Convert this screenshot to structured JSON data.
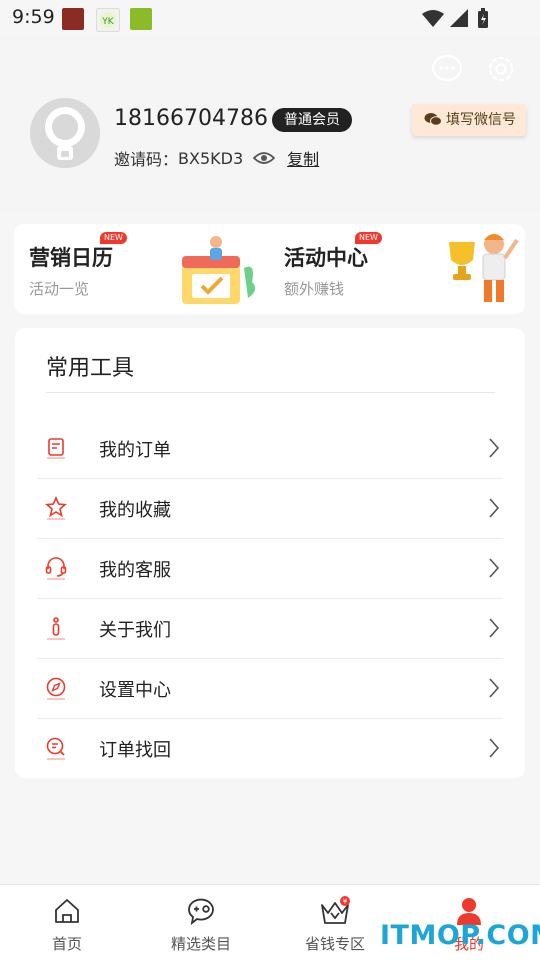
{
  "status_bar": {
    "time": "9:59",
    "app_icons": [
      "calligraphy-app-icon",
      "yk-app-icon",
      "green-app-icon"
    ],
    "indicators": [
      "wifi-icon",
      "signal-icon",
      "battery-icon"
    ]
  },
  "profile": {
    "phone": "18166704786",
    "member_level": "普通会员",
    "invite_label": "邀请码：",
    "invite_code": "BX5KD3",
    "copy_label": "复制",
    "wechat_button": "填写微信号"
  },
  "promos": [
    {
      "title": "营销日历",
      "subtitle": "活动一览",
      "tag": "NEW",
      "icon": "calendar-illustration"
    },
    {
      "title": "活动中心",
      "subtitle": "额外赚钱",
      "tag": "NEW",
      "icon": "trophy-illustration"
    }
  ],
  "tools": {
    "title": "常用工具",
    "items": [
      {
        "label": "我的订单",
        "icon": "order-icon"
      },
      {
        "label": "我的收藏",
        "icon": "star-icon"
      },
      {
        "label": "我的客服",
        "icon": "headset-icon"
      },
      {
        "label": "关于我们",
        "icon": "info-icon"
      },
      {
        "label": "设置中心",
        "icon": "compass-icon"
      },
      {
        "label": "订单找回",
        "icon": "order-search-icon"
      }
    ]
  },
  "nav": [
    {
      "label": "首页",
      "icon": "home-icon",
      "active": false
    },
    {
      "label": "精选类目",
      "icon": "chat-category-icon",
      "active": false
    },
    {
      "label": "省钱专区",
      "icon": "crown-icon",
      "active": false
    },
    {
      "label": "我的",
      "icon": "user-icon",
      "active": true
    }
  ],
  "watermark": "ITMOP.COM",
  "colors": {
    "accent": "#ee3a2c",
    "badge_bg": "#222222",
    "wechat_bg": "#fde9d6",
    "watermark": "#1ca6d8"
  }
}
